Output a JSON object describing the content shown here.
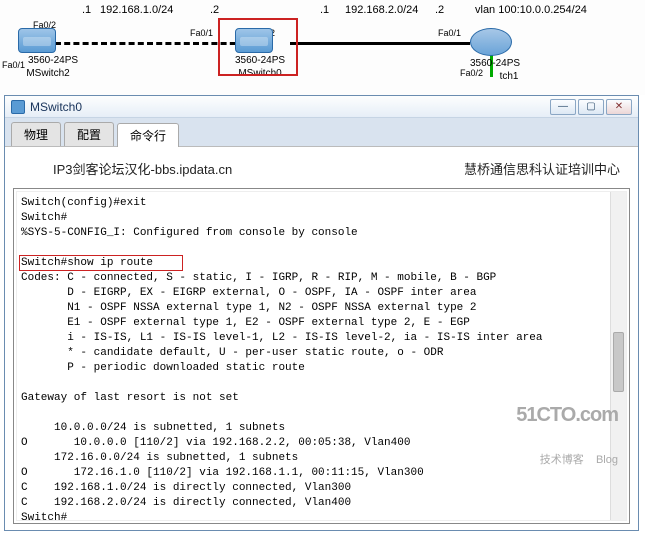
{
  "topology": {
    "net1": "192.168.1.0/24",
    "net2": "192.168.2.0/24",
    "vlan": "vlan 100:10.0.0.254/24",
    "dot1a": ".1",
    "dot1b": ".2",
    "dot2a": ".1",
    "dot2b": ".2",
    "ports": {
      "p_fa02_left": "Fa0/2",
      "p_fa01_left": "Fa0/1",
      "p_fa01_mid_l": "Fa0/1",
      "p_fa02_mid": "Fa0/2",
      "p_fa01_right": "Fa0/1",
      "p_fa02_right": "Fa0/2"
    },
    "devices": {
      "left_model": "3560-24PS",
      "left_name": "MSwitch2",
      "mid_model": "3560-24PS",
      "mid_name": "MSwitch0",
      "right_model": "3560-24PS",
      "right_name": "tch1"
    }
  },
  "window": {
    "title": "MSwitch0",
    "tabs": {
      "physical": "物理",
      "config": "配置",
      "cli": "命令行"
    },
    "heading_left": "IP3剑客论坛汉化-bbs.ipdata.cn",
    "heading_right": "慧桥通信思科认证培训中心"
  },
  "terminal": {
    "lines": [
      "Switch(config)#exit",
      "Switch#",
      "%SYS-5-CONFIG_I: Configured from console by console",
      "",
      "Switch#show ip route",
      "Codes: C - connected, S - static, I - IGRP, R - RIP, M - mobile, B - BGP",
      "       D - EIGRP, EX - EIGRP external, O - OSPF, IA - OSPF inter area",
      "       N1 - OSPF NSSA external type 1, N2 - OSPF NSSA external type 2",
      "       E1 - OSPF external type 1, E2 - OSPF external type 2, E - EGP",
      "       i - IS-IS, L1 - IS-IS level-1, L2 - IS-IS level-2, ia - IS-IS inter area",
      "       * - candidate default, U - per-user static route, o - ODR",
      "       P - periodic downloaded static route",
      "",
      "Gateway of last resort is not set",
      "",
      "     10.0.0.0/24 is subnetted, 1 subnets",
      "O       10.0.0.0 [110/2] via 192.168.2.2, 00:05:38, Vlan400",
      "     172.16.0.0/24 is subnetted, 1 subnets",
      "O       172.16.1.0 [110/2] via 192.168.1.1, 00:11:15, Vlan300",
      "C    192.168.1.0/24 is directly connected, Vlan300",
      "C    192.168.2.0/24 is directly connected, Vlan400",
      "Switch#"
    ]
  },
  "watermark": {
    "big": "51CTO.com",
    "small": "技术博客    Blog"
  }
}
